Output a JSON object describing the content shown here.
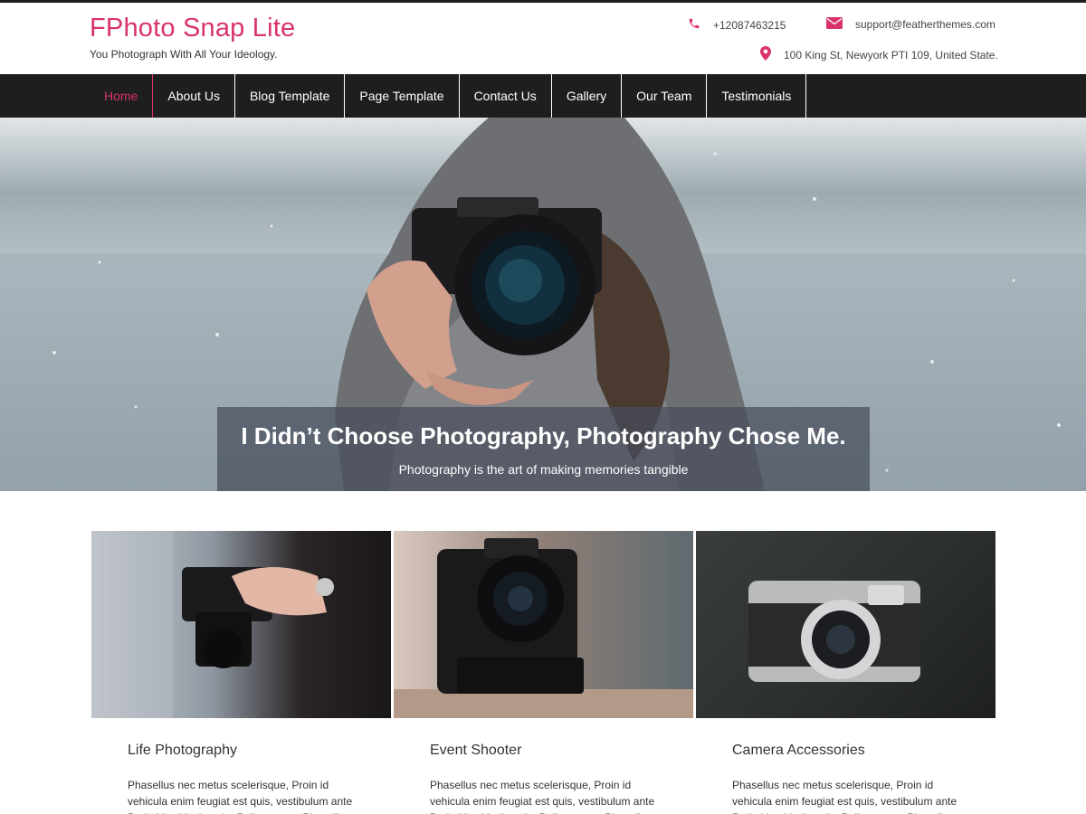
{
  "site": {
    "title": "FPhoto Snap Lite",
    "tagline": "You Photograph With All Your Ideology."
  },
  "contact": {
    "phone": "+12087463215",
    "phone_icon": "phone-icon",
    "email": "support@featherthemes.com",
    "email_icon": "envelope-icon",
    "address": "100 King St, Newyork PTI 109, United State.",
    "address_icon": "map-pin-icon"
  },
  "nav": {
    "items": [
      {
        "label": "Home",
        "active": true
      },
      {
        "label": "About Us"
      },
      {
        "label": "Blog Template"
      },
      {
        "label": "Page Template"
      },
      {
        "label": "Contact Us"
      },
      {
        "label": "Gallery"
      },
      {
        "label": "Our Team"
      },
      {
        "label": "Testimonials"
      }
    ]
  },
  "hero": {
    "title": "I Didn’t Choose Photography, Photography Chose Me.",
    "subtitle": "Photography is the art of making memories tangible"
  },
  "features": [
    {
      "title": "Life Photography",
      "text": "Phasellus nec metus scelerisque, Proin id vehicula enim feugiat est quis, vestibulum ante Proin id vehicula enim Pellentesque Phasellus"
    },
    {
      "title": "Event Shooter",
      "text": "Phasellus nec metus scelerisque, Proin id vehicula enim feugiat est quis, vestibulum ante Proin id vehicula enim Pellentesque Phasellus"
    },
    {
      "title": "Camera Accessories",
      "text": "Phasellus nec metus scelerisque, Proin id vehicula enim feugiat est quis, vestibulum ante Proin id vehicula enim Pellentesque Phasellus"
    }
  ],
  "colors": {
    "accent": "#d9336a",
    "nav_bg": "#1e1e1e"
  }
}
